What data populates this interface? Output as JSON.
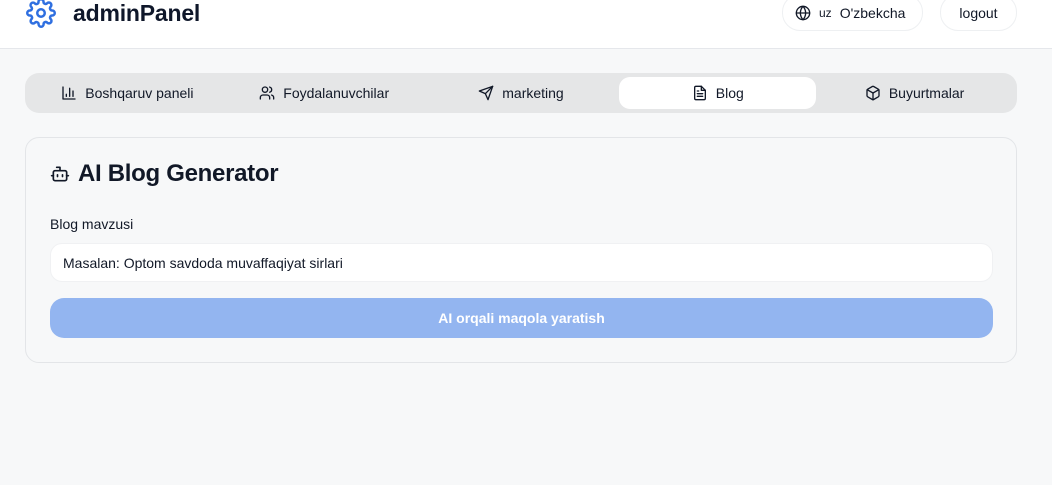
{
  "header": {
    "brand_icon": "gear-icon",
    "title": "adminPanel",
    "language": {
      "icon": "globe-icon",
      "code": "uz",
      "name": "O'zbekcha"
    },
    "logout_label": "logout"
  },
  "tabs": [
    {
      "label": "Boshqaruv paneli",
      "icon": "bar-chart-icon",
      "active": false
    },
    {
      "label": "Foydalanuvchilar",
      "icon": "users-icon",
      "active": false
    },
    {
      "label": "marketing",
      "icon": "send-icon",
      "active": false
    },
    {
      "label": "Blog",
      "icon": "file-text-icon",
      "active": true
    },
    {
      "label": "Buyurtmalar",
      "icon": "package-icon",
      "active": false
    }
  ],
  "generator": {
    "icon": "bot-icon",
    "title": "AI Blog Generator",
    "field_label": "Blog mavzusi",
    "input_value": "",
    "input_placeholder": "Masalan: Optom savdoda muvaffaqiyat sirlari",
    "button_label": "AI orqali maqola yaratish",
    "button_disabled": true
  },
  "colors": {
    "accent": "#2f6fe0",
    "button_disabled_bg": "#93b5f0",
    "tabs_bg": "#e5e6e7",
    "page_bg": "#f7f8f9"
  }
}
